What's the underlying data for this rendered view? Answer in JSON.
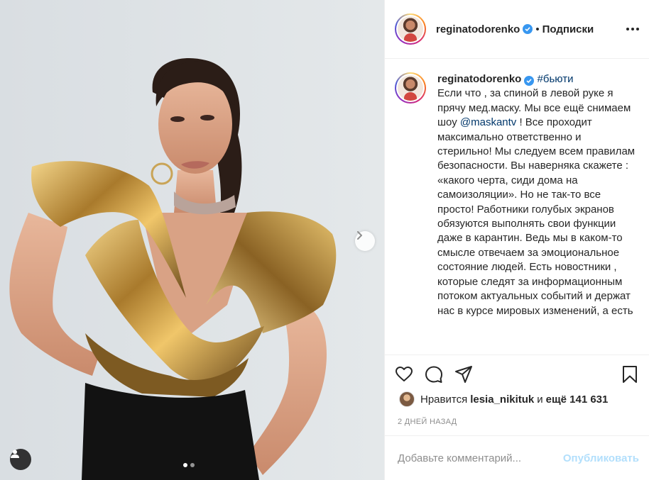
{
  "post": {
    "author": "reginatodorenko",
    "follow_label": "Подписки",
    "header_separator": "•"
  },
  "caption": {
    "author": "reginatodorenko",
    "hashtag": "#бьюти",
    "text_before_mention": "Если что , за спиной в левой руке я прячу мед.маску. Мы все ещё снимаем шоу ",
    "mention": "@maskantv",
    "text_after_mention": " ! Все проходит максимально ответственно и стерильно! Мы следуем всем правилам безопасности. Вы наверняка скажете : «какого черта, сиди дома на самоизоляции». Но не так-то все просто! Работники голубых экранов обязуются выполнять свои функции даже в карантин. Ведь мы в каком-то смысле отвечаем за эмоциональное состояние людей. Есть новостники , которые следят за информационным потоком актуальных событий и держат нас в курсе мировых изменений, а есть"
  },
  "likes": {
    "prefix": "Нравится",
    "user": "lesia_nikituk",
    "conjunction": "и",
    "count_text": "ещё 141 631"
  },
  "timestamp": "2 ДНЕЙ НАЗАД",
  "comment": {
    "placeholder": "Добавьте комментарий...",
    "publish_label": "Опубликовать"
  },
  "carousel": {
    "total": 2,
    "active_index": 0
  },
  "icons": {
    "verified": "verified-badge-icon",
    "more": "more-options-icon",
    "like": "heart-icon",
    "comment": "comment-icon",
    "share": "share-icon",
    "save": "bookmark-icon",
    "next": "chevron-right-icon",
    "tags": "user-tag-icon"
  },
  "colors": {
    "accent": "#3897f0",
    "publish_disabled": "#b2dffc",
    "link": "#00376b"
  }
}
